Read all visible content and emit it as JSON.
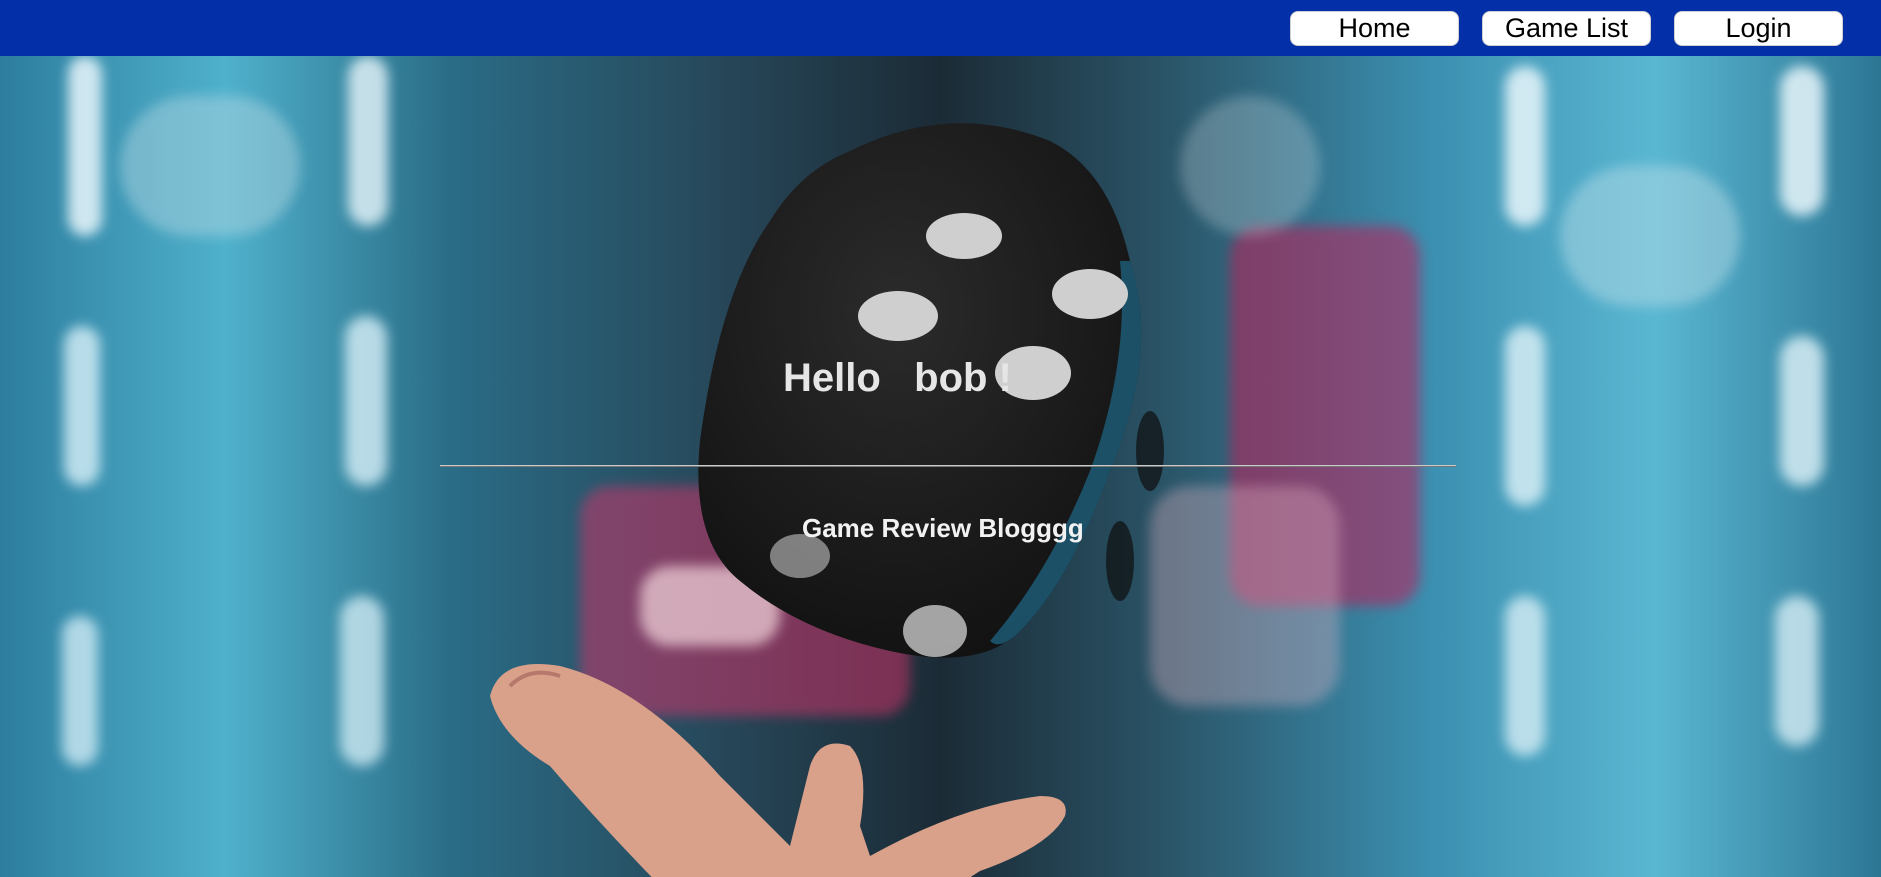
{
  "nav": {
    "home_label": "Home",
    "game_list_label": "Game List",
    "login_label": "Login"
  },
  "hero": {
    "greeting": "Hello   bob !",
    "subtitle": "Game Review Blogggg",
    "background_image": "dice-toss-photo"
  },
  "colors": {
    "navbar": "#0330a8",
    "button_bg": "#ffffff",
    "text_light": "#e6e6e6"
  }
}
